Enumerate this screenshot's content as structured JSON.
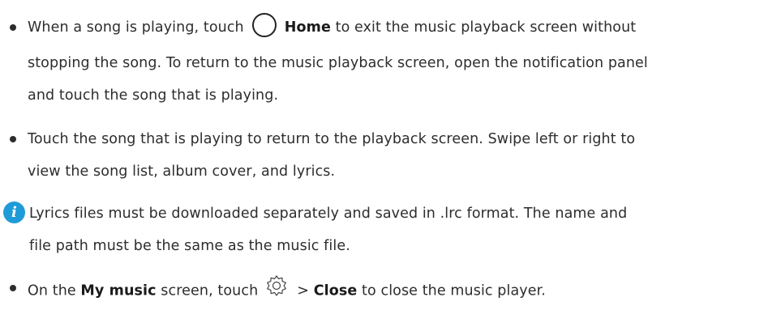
{
  "item1": {
    "line1_a": "When a song is playing, touch",
    "home_label": "Home",
    "line1_b": "to exit the music playback screen without",
    "line2": "stopping the song. To return to the music playback screen, open the notification panel",
    "line3": "and touch the song that is playing."
  },
  "item2": {
    "line1": "Touch the song that is playing to return to the playback screen. Swipe left or right to",
    "line2": "view the song list, album cover, and lyrics."
  },
  "note": {
    "icon_glyph": "i",
    "line1": "Lyrics files must be downloaded separately and saved in .lrc format. The name and",
    "line2": "file path must be the same as the music file."
  },
  "item3": {
    "pre": "On the",
    "my_music": "My music",
    "mid": "screen, touch",
    "gt": ">",
    "close_label": "Close",
    "post": "to close the music player."
  }
}
